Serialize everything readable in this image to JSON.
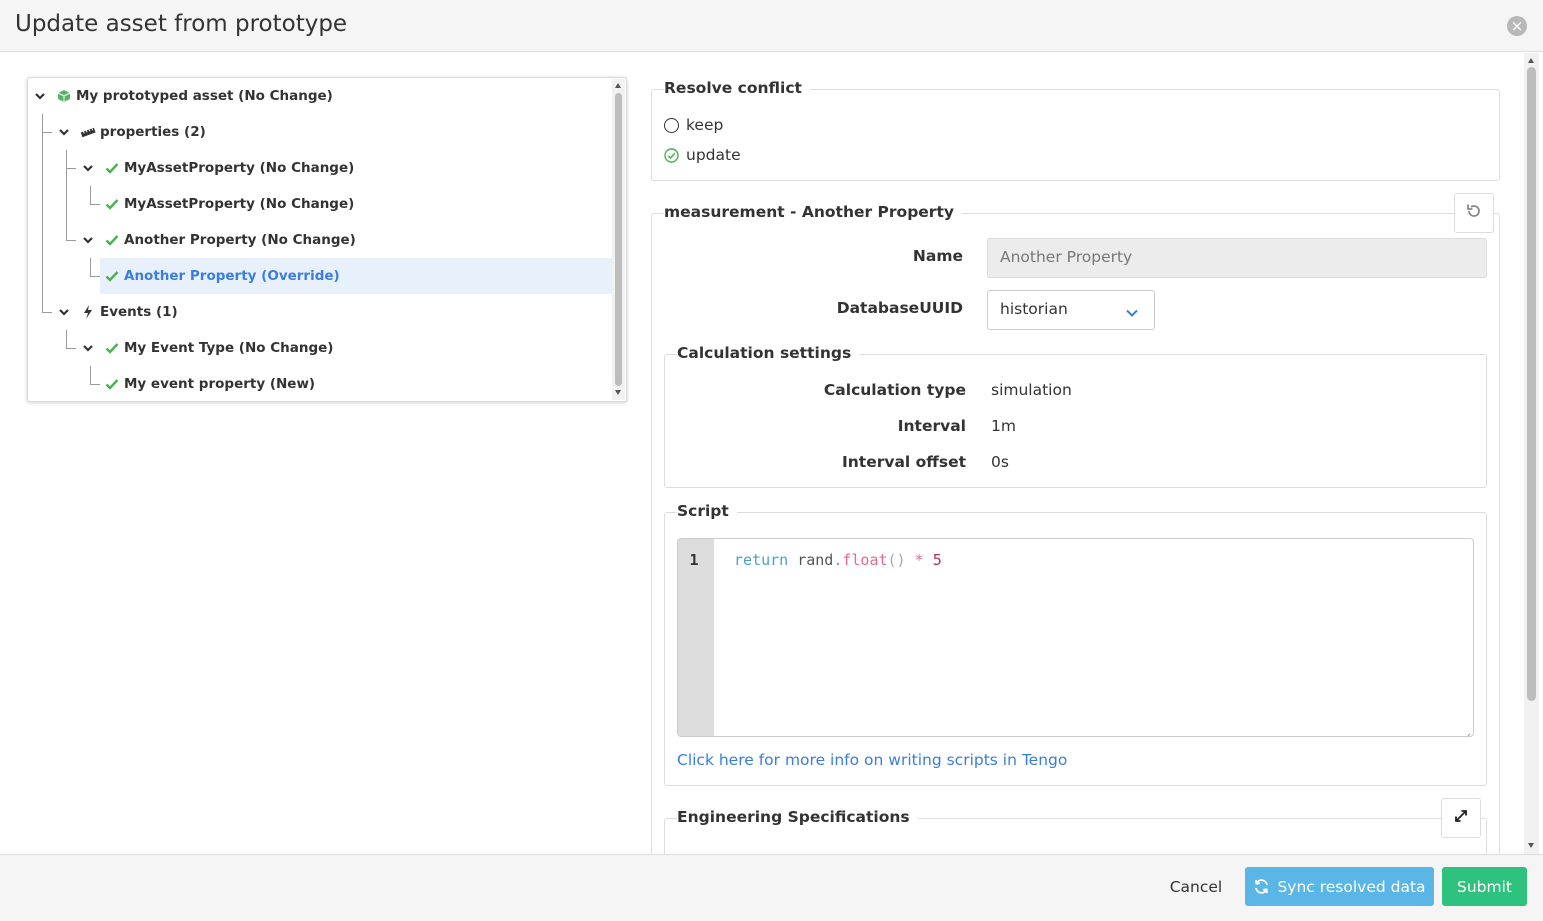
{
  "dialog": {
    "title": "Update asset from prototype"
  },
  "tree": {
    "nodes": [
      {
        "label": "My prototyped asset (No Change)",
        "icon": "cube-icon"
      },
      {
        "label": "properties (2)",
        "icon": "ruler-icon"
      },
      {
        "label": "MyAssetProperty (No Change)",
        "icon": "check-icon"
      },
      {
        "label": "MyAssetProperty (No Change)",
        "icon": "check-icon"
      },
      {
        "label": "Another Property (No Change)",
        "icon": "check-icon"
      },
      {
        "label": "Another Property (Override)",
        "icon": "check-icon",
        "selected": true
      },
      {
        "label": "Events (1)",
        "icon": "bolt-icon"
      },
      {
        "label": "My Event Type (No Change)",
        "icon": "check-icon"
      },
      {
        "label": "My event property (New)",
        "icon": "check-icon"
      }
    ]
  },
  "resolve": {
    "legend": "Resolve conflict",
    "options": [
      {
        "label": "keep",
        "selected": false
      },
      {
        "label": "update",
        "selected": true
      }
    ]
  },
  "measurement": {
    "legend": "measurement - Another Property",
    "name_label": "Name",
    "name_value": "Another Property",
    "db_label": "DatabaseUUID",
    "db_value": "historian"
  },
  "calc": {
    "legend": "Calculation settings",
    "type_label": "Calculation type",
    "type_value": "simulation",
    "interval_label": "Interval",
    "interval_value": "1m",
    "offset_label": "Interval offset",
    "offset_value": "0s"
  },
  "script": {
    "legend": "Script",
    "line_number": "1",
    "tokens": {
      "kw": "return",
      "id": " rand",
      "dot": ".",
      "fn": "float",
      "paren": "()",
      "op": " * ",
      "num": "5"
    },
    "info_link": "Click here for more info on writing scripts in Tengo"
  },
  "engineering": {
    "legend": "Engineering Specifications"
  },
  "footer": {
    "cancel": "Cancel",
    "sync": "Sync resolved data",
    "submit": "Submit"
  },
  "colors": {
    "accent": "#3b7ddd",
    "success": "#2ec27e",
    "info": "#5bb6e8",
    "check": "#4caf50"
  }
}
